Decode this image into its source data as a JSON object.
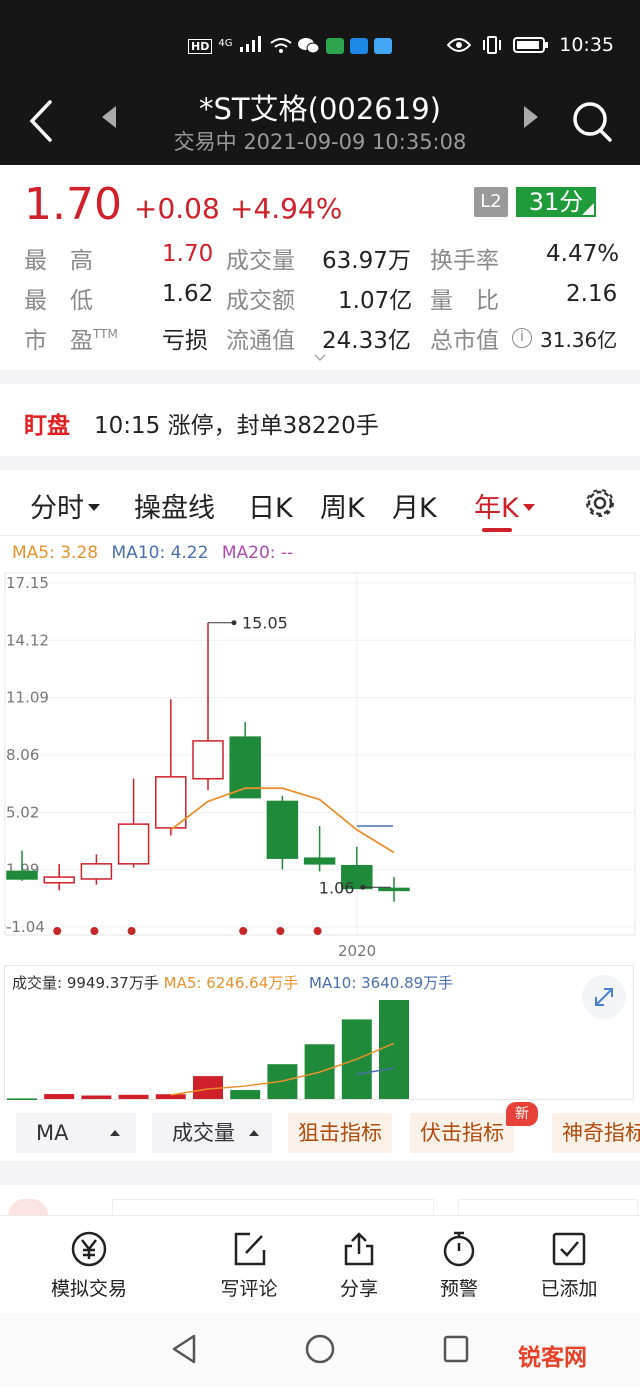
{
  "status_bar": {
    "time": "10:35",
    "net_label": "HD",
    "signal_label": "4G",
    "icons": [
      "signal-icon",
      "wifi-icon",
      "wechat-icon",
      "eye-icon",
      "vibrate-icon",
      "battery-icon"
    ]
  },
  "header": {
    "title": "*ST艾格(002619)",
    "subtitle": "交易中 2021-09-09 10:35:08"
  },
  "quote": {
    "price": "1.70",
    "change": "+0.08",
    "change_pct": "+4.94%",
    "l2_badge": "L2",
    "score": "31分",
    "rows": [
      [
        {
          "label": "最　高",
          "value": "1.70"
        },
        {
          "label": "成交量",
          "value": "63.97万"
        },
        {
          "label": "换手率",
          "value": "4.47%"
        }
      ],
      [
        {
          "label": "最　低",
          "value": "1.62"
        },
        {
          "label": "成交额",
          "value": "1.07亿"
        },
        {
          "label": "量　比",
          "value": "2.16"
        }
      ],
      [
        {
          "label": "市　盈",
          "label_sup": "TTM",
          "value": "亏损"
        },
        {
          "label": "流通值",
          "value": "24.33亿"
        },
        {
          "label": "总市值",
          "value": "31.36亿"
        }
      ]
    ]
  },
  "monitor": {
    "badge": "盯盘",
    "text": "10:15 涨停，封单38220手"
  },
  "tabs": [
    {
      "label": "分时",
      "dropdown": true,
      "active": false
    },
    {
      "label": "操盘线",
      "dropdown": false,
      "active": false
    },
    {
      "label": "日K",
      "dropdown": false,
      "active": false
    },
    {
      "label": "周K",
      "dropdown": false,
      "active": false
    },
    {
      "label": "月K",
      "dropdown": false,
      "active": false
    },
    {
      "label": "年K",
      "dropdown": true,
      "active": true
    }
  ],
  "ma_legend": [
    {
      "text": "MA5: 3.28",
      "color": "#e8912c"
    },
    {
      "text": "MA10: 4.22",
      "color": "#4a6fb0"
    },
    {
      "text": "MA20: --",
      "color": "#b04ab0"
    }
  ],
  "chart_data": {
    "type": "candlestick",
    "y_ticks": [
      "17.15",
      "14.12",
      "11.09",
      "8.06",
      "5.02",
      "1.99",
      "-1.04"
    ],
    "ylim": [
      -1.04,
      17.15
    ],
    "x_label": "2020",
    "max_label": "15.05",
    "min_label": "1.06",
    "candles": [
      {
        "open": 1.9,
        "close": 1.5,
        "high": 3.0,
        "low": 1.4
      },
      {
        "open": 1.3,
        "close": 1.6,
        "high": 2.3,
        "low": 0.9
      },
      {
        "open": 1.5,
        "close": 2.3,
        "high": 2.8,
        "low": 1.2
      },
      {
        "open": 2.3,
        "close": 4.4,
        "high": 6.8,
        "low": 2.1
      },
      {
        "open": 4.2,
        "close": 6.9,
        "high": 11.0,
        "low": 3.8
      },
      {
        "open": 6.8,
        "close": 8.8,
        "high": 15.05,
        "low": 6.2
      },
      {
        "open": 9.0,
        "close": 5.8,
        "high": 9.8,
        "low": 5.8
      },
      {
        "open": 5.6,
        "close": 2.6,
        "high": 5.9,
        "low": 2.0
      },
      {
        "open": 2.6,
        "close": 2.3,
        "high": 4.3,
        "low": 1.9
      },
      {
        "open": 2.2,
        "close": 1.0,
        "high": 3.2,
        "low": 1.0
      },
      {
        "open": 1.0,
        "close": 0.9,
        "high": 1.6,
        "low": 0.3
      }
    ],
    "ma5": [
      null,
      null,
      null,
      null,
      4.1,
      5.6,
      6.3,
      6.3,
      5.7,
      4.1,
      2.9
    ],
    "signal_dots": [
      1,
      2,
      3,
      6,
      7,
      8
    ],
    "colors": {
      "up": "#d0202a",
      "down": "#1f8b3a",
      "ma5": "#e8912c",
      "ma10": "#4a6fb0"
    },
    "volume": {
      "label": "成交量: 9949.37万手",
      "ma5_label": "MA5: 6246.64万手",
      "ma10_label": "MA10: 3640.89万手",
      "values": [
        60,
        500,
        350,
        420,
        480,
        2300,
        900,
        3500,
        5500,
        8000,
        9949.37
      ],
      "ma5_line": [
        null,
        null,
        null,
        null,
        400,
        1000,
        1300,
        1800,
        2700,
        4000,
        5600
      ],
      "ma10_line": [
        null,
        null,
        null,
        null,
        null,
        null,
        null,
        null,
        null,
        2500,
        3100
      ]
    }
  },
  "indicators": [
    {
      "label": "MA",
      "style": "gray"
    },
    {
      "label": "成交量",
      "style": "gray"
    },
    {
      "label": "狙击指标",
      "style": "warm"
    },
    {
      "label": "伏击指标",
      "style": "warm",
      "badge": "新"
    },
    {
      "label": "神奇指标",
      "style": "warm"
    }
  ],
  "actions": [
    {
      "label": "模拟交易",
      "icon": "yen-icon"
    },
    {
      "label": "写评论",
      "icon": "edit-icon"
    },
    {
      "label": "分享",
      "icon": "share-icon"
    },
    {
      "label": "预警",
      "icon": "timer-icon"
    },
    {
      "label": "已添加",
      "icon": "checkbox-icon"
    }
  ],
  "watermark": "锐客网"
}
